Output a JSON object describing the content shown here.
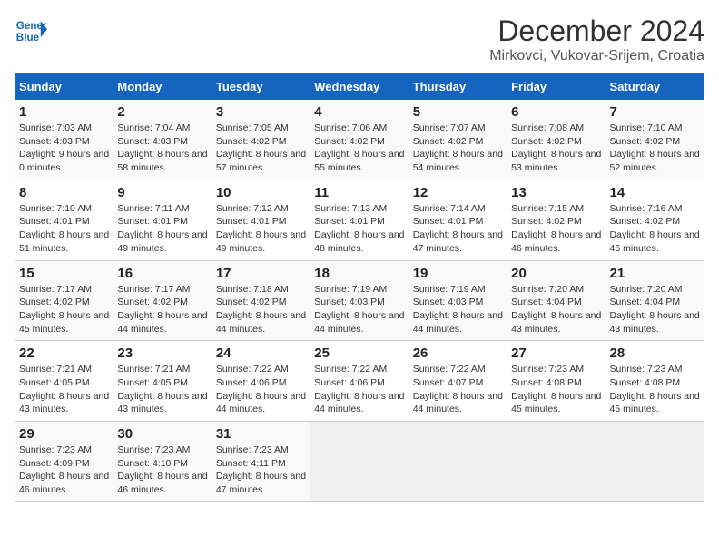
{
  "header": {
    "logo_line1": "General",
    "logo_line2": "Blue",
    "month": "December 2024",
    "location": "Mirkovci, Vukovar-Srijem, Croatia"
  },
  "weekdays": [
    "Sunday",
    "Monday",
    "Tuesday",
    "Wednesday",
    "Thursday",
    "Friday",
    "Saturday"
  ],
  "weeks": [
    [
      {
        "day": 1,
        "sunrise": "7:03 AM",
        "sunset": "4:03 PM",
        "daylight": "9 hours and 0 minutes."
      },
      {
        "day": 2,
        "sunrise": "7:04 AM",
        "sunset": "4:03 PM",
        "daylight": "8 hours and 58 minutes."
      },
      {
        "day": 3,
        "sunrise": "7:05 AM",
        "sunset": "4:02 PM",
        "daylight": "8 hours and 57 minutes."
      },
      {
        "day": 4,
        "sunrise": "7:06 AM",
        "sunset": "4:02 PM",
        "daylight": "8 hours and 55 minutes."
      },
      {
        "day": 5,
        "sunrise": "7:07 AM",
        "sunset": "4:02 PM",
        "daylight": "8 hours and 54 minutes."
      },
      {
        "day": 6,
        "sunrise": "7:08 AM",
        "sunset": "4:02 PM",
        "daylight": "8 hours and 53 minutes."
      },
      {
        "day": 7,
        "sunrise": "7:10 AM",
        "sunset": "4:02 PM",
        "daylight": "8 hours and 52 minutes."
      }
    ],
    [
      {
        "day": 8,
        "sunrise": "7:10 AM",
        "sunset": "4:01 PM",
        "daylight": "8 hours and 51 minutes."
      },
      {
        "day": 9,
        "sunrise": "7:11 AM",
        "sunset": "4:01 PM",
        "daylight": "8 hours and 49 minutes."
      },
      {
        "day": 10,
        "sunrise": "7:12 AM",
        "sunset": "4:01 PM",
        "daylight": "8 hours and 49 minutes."
      },
      {
        "day": 11,
        "sunrise": "7:13 AM",
        "sunset": "4:01 PM",
        "daylight": "8 hours and 48 minutes."
      },
      {
        "day": 12,
        "sunrise": "7:14 AM",
        "sunset": "4:01 PM",
        "daylight": "8 hours and 47 minutes."
      },
      {
        "day": 13,
        "sunrise": "7:15 AM",
        "sunset": "4:02 PM",
        "daylight": "8 hours and 46 minutes."
      },
      {
        "day": 14,
        "sunrise": "7:16 AM",
        "sunset": "4:02 PM",
        "daylight": "8 hours and 46 minutes."
      }
    ],
    [
      {
        "day": 15,
        "sunrise": "7:17 AM",
        "sunset": "4:02 PM",
        "daylight": "8 hours and 45 minutes."
      },
      {
        "day": 16,
        "sunrise": "7:17 AM",
        "sunset": "4:02 PM",
        "daylight": "8 hours and 44 minutes."
      },
      {
        "day": 17,
        "sunrise": "7:18 AM",
        "sunset": "4:02 PM",
        "daylight": "8 hours and 44 minutes."
      },
      {
        "day": 18,
        "sunrise": "7:19 AM",
        "sunset": "4:03 PM",
        "daylight": "8 hours and 44 minutes."
      },
      {
        "day": 19,
        "sunrise": "7:19 AM",
        "sunset": "4:03 PM",
        "daylight": "8 hours and 44 minutes."
      },
      {
        "day": 20,
        "sunrise": "7:20 AM",
        "sunset": "4:04 PM",
        "daylight": "8 hours and 43 minutes."
      },
      {
        "day": 21,
        "sunrise": "7:20 AM",
        "sunset": "4:04 PM",
        "daylight": "8 hours and 43 minutes."
      }
    ],
    [
      {
        "day": 22,
        "sunrise": "7:21 AM",
        "sunset": "4:05 PM",
        "daylight": "8 hours and 43 minutes."
      },
      {
        "day": 23,
        "sunrise": "7:21 AM",
        "sunset": "4:05 PM",
        "daylight": "8 hours and 43 minutes."
      },
      {
        "day": 24,
        "sunrise": "7:22 AM",
        "sunset": "4:06 PM",
        "daylight": "8 hours and 44 minutes."
      },
      {
        "day": 25,
        "sunrise": "7:22 AM",
        "sunset": "4:06 PM",
        "daylight": "8 hours and 44 minutes."
      },
      {
        "day": 26,
        "sunrise": "7:22 AM",
        "sunset": "4:07 PM",
        "daylight": "8 hours and 44 minutes."
      },
      {
        "day": 27,
        "sunrise": "7:23 AM",
        "sunset": "4:08 PM",
        "daylight": "8 hours and 45 minutes."
      },
      {
        "day": 28,
        "sunrise": "7:23 AM",
        "sunset": "4:08 PM",
        "daylight": "8 hours and 45 minutes."
      }
    ],
    [
      {
        "day": 29,
        "sunrise": "7:23 AM",
        "sunset": "4:09 PM",
        "daylight": "8 hours and 46 minutes."
      },
      {
        "day": 30,
        "sunrise": "7:23 AM",
        "sunset": "4:10 PM",
        "daylight": "8 hours and 46 minutes."
      },
      {
        "day": 31,
        "sunrise": "7:23 AM",
        "sunset": "4:11 PM",
        "daylight": "8 hours and 47 minutes."
      },
      null,
      null,
      null,
      null
    ]
  ]
}
